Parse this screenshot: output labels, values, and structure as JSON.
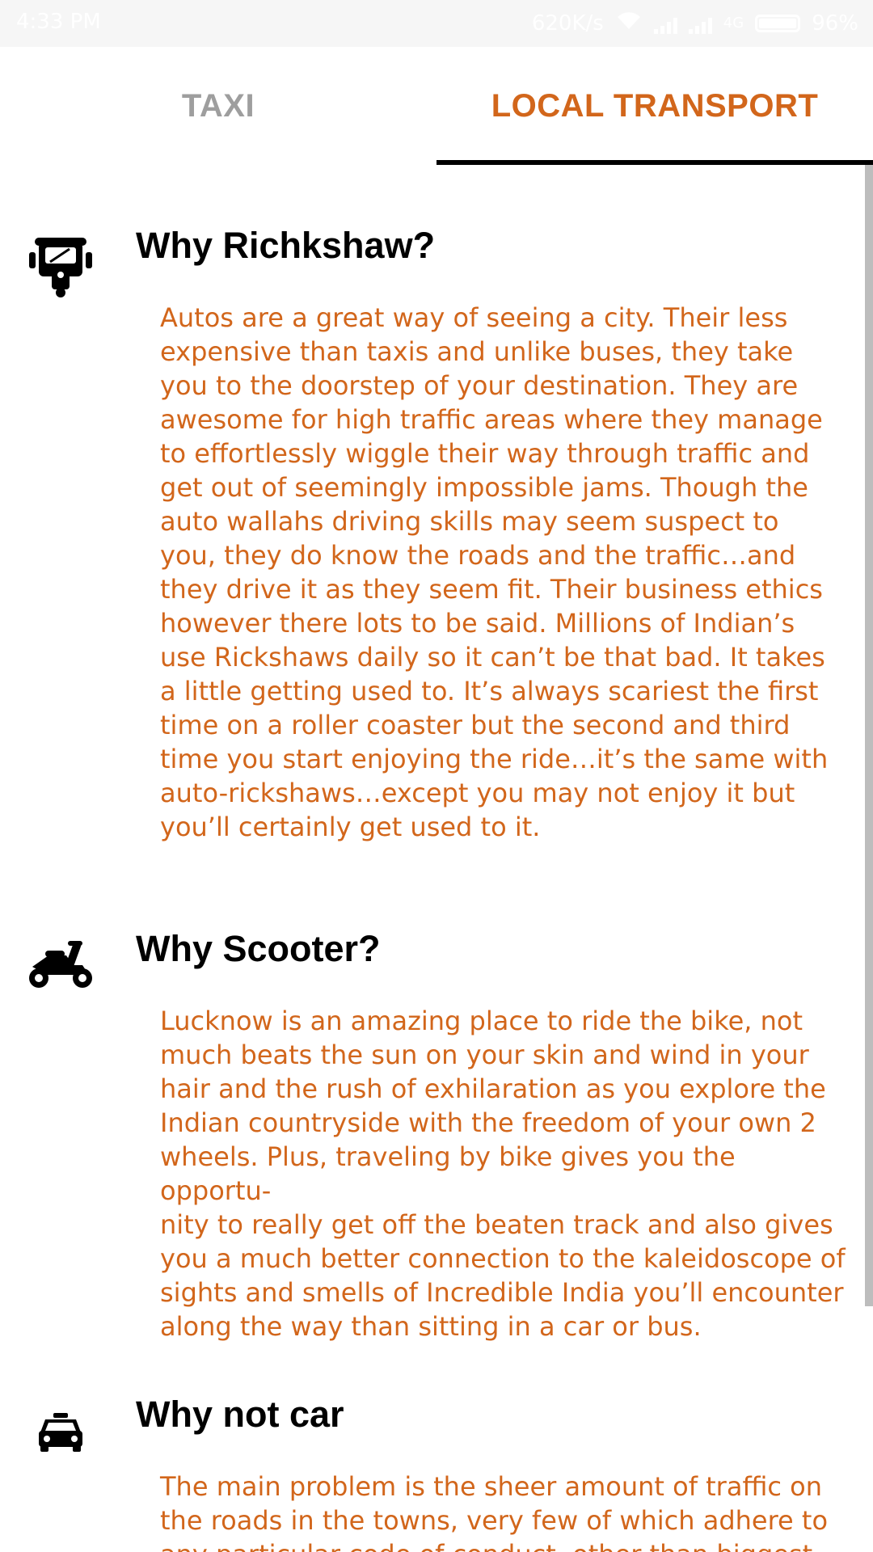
{
  "status_bar": {
    "time": "4:33 PM",
    "network_speed": "620K/s",
    "network_type": "4G",
    "battery": "96%"
  },
  "tabs": [
    {
      "label": "TAXI",
      "selected": false
    },
    {
      "label": "LOCAL TRANSPORT",
      "selected": true
    }
  ],
  "accent_color": "#d2661b",
  "sections": [
    {
      "icon": "auto-rickshaw-icon",
      "title": "Why Richkshaw?",
      "body": "Autos are a great way of seeing a city. Their less\nexpensive than taxis and unlike buses, they take\nyou to the doorstep of your destination. They are\nawesome for high traffic areas where they manage\nto effortlessly wiggle their way through traffic and\nget out of seemingly impossible jams. Though the\nauto wallahs driving skills may seem suspect to\nyou, they do know the roads and the traffic…and\nthey drive it as they seem fit. Their business ethics\nhowever there lots to be said. Millions of Indian’s\nuse Rickshaws daily so it can’t be that bad. It takes\na little getting used to. It’s always scariest the first\ntime on a roller coaster but the second and third\ntime you start enjoying the ride…it’s the same with\nauto-rickshaws…except you may not enjoy it but\nyou’ll certainly get used to it."
    },
    {
      "icon": "scooter-icon",
      "title": "Why Scooter?",
      "body": "Lucknow is an amazing place to ride the bike, not\nmuch beats the sun on your skin and wind in your\nhair and the rush of exhilaration as you explore the\nIndian countryside with the freedom of your own 2\nwheels. Plus, traveling by bike gives you the opportu-\nnity to really get off the beaten track and also gives\nyou a much better connection to the kaleidoscope of\nsights and smells of Incredible India you’ll encounter\nalong the way than sitting in a car or bus."
    },
    {
      "icon": "car-icon",
      "title": "Why not car",
      "body": "The main problem is the sheer amount of traffic on\nthe roads in the towns, very few of which adhere to\nany particular code of conduct, other than biggest"
    }
  ]
}
